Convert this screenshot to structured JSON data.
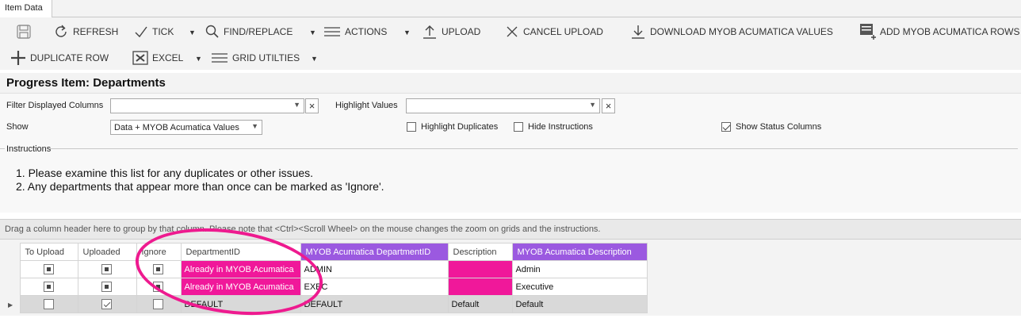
{
  "tab": {
    "label": "Item Data"
  },
  "toolbar": {
    "refresh": "REFRESH",
    "tick": "TICK",
    "find_replace": "FIND/REPLACE",
    "actions": "ACTIONS",
    "upload": "UPLOAD",
    "cancel_upload": "CANCEL UPLOAD",
    "download": "DOWNLOAD MYOB ACUMATICA VALUES",
    "add_rows": "ADD MYOB ACUMATICA ROWS",
    "duplicate_row": "DUPLICATE ROW",
    "excel": "EXCEL",
    "grid_utilities": "GRID UTILTIES"
  },
  "section": {
    "title": "Progress Item: Departments"
  },
  "options": {
    "filter_label": "Filter Displayed Columns",
    "filter_value": "",
    "highlight_label": "Highlight Values",
    "highlight_value": "",
    "show_label": "Show",
    "show_value": "Data + MYOB Acumatica Values",
    "highlight_duplicates": "Highlight Duplicates",
    "highlight_duplicates_checked": false,
    "hide_instructions": "Hide Instructions",
    "hide_instructions_checked": false,
    "show_status_columns": "Show Status Columns",
    "show_status_columns_checked": true
  },
  "instructions": {
    "heading": "Instructions",
    "items": [
      "1.  Please examine this list for any duplicates or other issues.",
      "2.  Any departments that appear more than once can be marked as 'Ignore'."
    ]
  },
  "group_area": {
    "text": "Drag a column header here to group by that column.    Please note that <Ctrl><Scroll Wheel> on the mouse changes the zoom on grids and the instructions."
  },
  "grid": {
    "columns": [
      "To Upload",
      "Uploaded",
      "Ignore",
      "DepartmentID",
      "MYOB Acumatica DepartmentID",
      "Description",
      "MYOB Acumatica Description"
    ],
    "rows": [
      {
        "to_upload": "indeterminate",
        "uploaded": "indeterminate",
        "ignore": "indeterminate",
        "department_id": "Already in MYOB Acumatica",
        "myob_department_id": "ADMIN",
        "description": "",
        "myob_description": "Admin"
      },
      {
        "to_upload": "indeterminate",
        "uploaded": "indeterminate",
        "ignore": "indeterminate",
        "department_id": "Already in MYOB Acumatica",
        "myob_department_id": "EXEC",
        "description": "",
        "myob_description": "Executive"
      },
      {
        "to_upload": "unchecked",
        "uploaded": "checked",
        "ignore": "unchecked",
        "department_id": "DEFAULT",
        "myob_department_id": "DEFAULT",
        "description": "Default",
        "myob_description": "Default"
      }
    ]
  },
  "colors": {
    "highlight_pink": "#f0189a",
    "myob_purple": "#9b59e0",
    "annotation_circle": "#ee1a8f"
  }
}
